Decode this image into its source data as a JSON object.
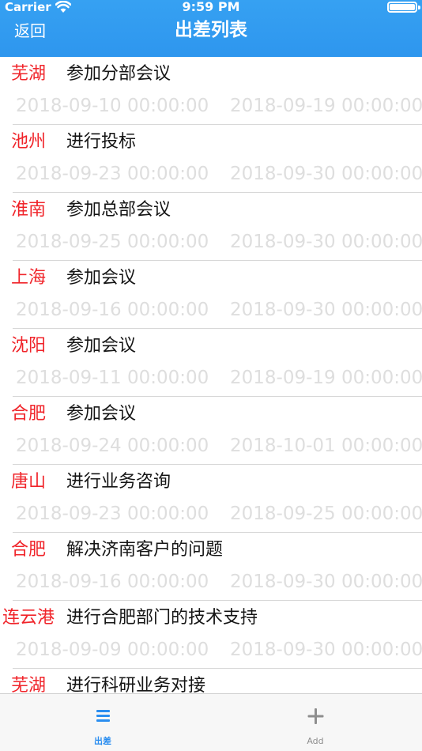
{
  "status": {
    "carrier": "Carrier",
    "time": "9:59 PM"
  },
  "nav": {
    "back_label": "返回",
    "title": "出差列表"
  },
  "trips": [
    {
      "city": "芜湖",
      "task": "参加分部会议",
      "start": "2018-09-10 00:00:00",
      "end": "2018-09-19 00:00:00"
    },
    {
      "city": "池州",
      "task": "进行投标",
      "start": "2018-09-23 00:00:00",
      "end": "2018-09-30 00:00:00"
    },
    {
      "city": "淮南",
      "task": "参加总部会议",
      "start": "2018-09-25 00:00:00",
      "end": "2018-09-30 00:00:00"
    },
    {
      "city": "上海",
      "task": "参加会议",
      "start": "2018-09-16 00:00:00",
      "end": "2018-09-30 00:00:00"
    },
    {
      "city": "沈阳",
      "task": "参加会议",
      "start": "2018-09-11 00:00:00",
      "end": "2018-09-19 00:00:00"
    },
    {
      "city": "合肥",
      "task": "参加会议",
      "start": "2018-09-24 00:00:00",
      "end": "2018-10-01 00:00:00"
    },
    {
      "city": "唐山",
      "task": "进行业务咨询",
      "start": "2018-09-23 00:00:00",
      "end": "2018-09-25 00:00:00"
    },
    {
      "city": "合肥",
      "task": "解决济南客户的问题",
      "start": "2018-09-16 00:00:00",
      "end": "2018-09-30 00:00:00"
    },
    {
      "city": "连云港",
      "task": "进行合肥部门的技术支持",
      "start": "2018-09-09 00:00:00",
      "end": "2018-09-30 00:00:00"
    },
    {
      "city": "芜湖",
      "task": "进行科研业务对接",
      "start": "",
      "end": ""
    }
  ],
  "tabbar": {
    "trips_label": "出差",
    "add_label": "Add"
  },
  "colors": {
    "nav_bar": "#36a1f2",
    "city_text": "#f0242a",
    "date_text": "#dedede",
    "tab_active": "#2b8ef0",
    "tab_inactive": "#8e8e8e"
  },
  "icons": {
    "trips_tab": "list-icon",
    "add_tab": "plus-icon"
  }
}
